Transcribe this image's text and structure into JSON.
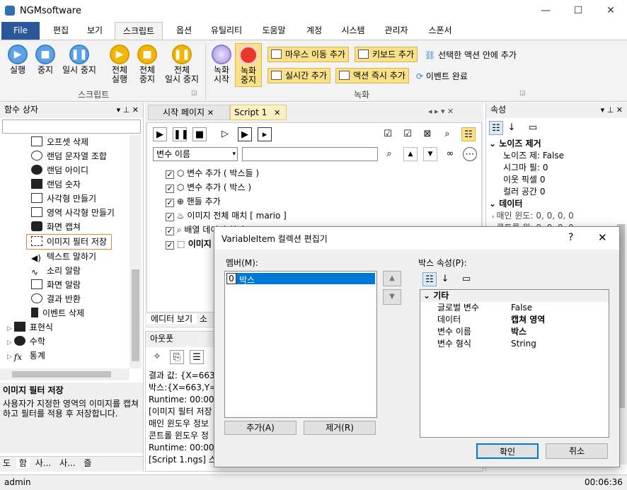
{
  "window": {
    "title": "NGMsoftware",
    "min": "—",
    "max": "☐",
    "close": "✕"
  },
  "tabs": [
    "File",
    "편집",
    "보기",
    "스크립트",
    "옵션",
    "유틸리티",
    "도움말",
    "계정",
    "시스템",
    "관리자",
    "스폰서"
  ],
  "ribbon": {
    "run": "실행",
    "stop": "중지",
    "pause": "일시 중지",
    "all_run": [
      "전체",
      "실행"
    ],
    "all_stop": [
      "전체",
      "중지"
    ],
    "all_pause": [
      "전체",
      "일시 중지"
    ],
    "rec_start": [
      "녹화",
      "시작"
    ],
    "rec_stop": [
      "녹화",
      "중지"
    ],
    "mouse_move": "마우스 이동 추가",
    "keyboard": "키보드 추가",
    "selected_action": "선택한 액션 안에 추가",
    "realtime": "실시간 추가",
    "action_now": "액션 즉시 추가",
    "event_done": "이벤트 완료",
    "group_script": "스크립트",
    "group_record": "녹화"
  },
  "func_panel": {
    "title": "함수 상자",
    "items": [
      "오프셋 삭제",
      "랜덤 문자열 조합",
      "랜덤 아이디",
      "랜덤 숫자",
      "사각형 만들기",
      "영역 사각형 만들기",
      "화면 캡쳐",
      "이미지 필터 저장",
      "텍스트 말하기",
      "소리 알람",
      "화면 알람",
      "결과 반환",
      "이벤트 삭제"
    ],
    "groups": [
      "표현식",
      "수학",
      "통계"
    ],
    "desc_title": "이미지 필터 저장",
    "desc_text": "사용자가 지정한 영역의 이미지를 캡쳐하고 필터를 적용 후 저장합니다.",
    "bottom_tabs": [
      "도",
      "함",
      "사...",
      "사...",
      "즐"
    ]
  },
  "editor": {
    "tab_start": "시작 페이지",
    "tab_script": "Script 1",
    "var_select": "변수 이름",
    "lines": [
      "변수 추가 ( 박스들 )",
      "변수 추가 ( 박스 )",
      "핸들 추가",
      "이미지 전체 매치 [ mario ]",
      "배열 데이터 처리",
      "이미지"
    ],
    "view_tabs": [
      "에디터 보기",
      "소"
    ]
  },
  "output": {
    "title": "아웃풋",
    "lines": [
      "결과 값: {X=663,",
      "박스:{X=663,Y=1",
      "Runtime: 00:00:00",
      "[이미지 필터 저장",
      "매인 윈도우 정보",
      "콘트롤 윈도우 정",
      "Runtime: 00:00:00",
      "[Script 1.ngs] 스크"
    ]
  },
  "props": {
    "title": "속성",
    "cat1": "노이즈 제거",
    "rows1": [
      [
        "노이즈 제:",
        "False"
      ],
      [
        "시그마 필:",
        "0"
      ],
      [
        "이웃 픽셀",
        "0"
      ],
      [
        "컬러 공간",
        "0"
      ]
    ],
    "cat2": "데이터",
    "rows2": [
      [
        "매인 윈도:",
        "0, 0, 0, 0"
      ],
      [
        "콘트롤 윈:",
        "0, 0, 0, 0"
      ]
    ]
  },
  "dialog": {
    "title": "VariableItem 컬렉션 편집기",
    "help": "?",
    "close": "✕",
    "members_label": "멤버(M):",
    "member_index": "0",
    "member_name": "박스",
    "props_label": "박스 속성(P):",
    "cat": "기타",
    "rows": [
      [
        "글로벌 변수",
        "False"
      ],
      [
        "데이터",
        "캡쳐 영역"
      ],
      [
        "변수 이름",
        "박스"
      ],
      [
        "변수 형식",
        "String"
      ]
    ],
    "add": "추가(A)",
    "remove": "제거(R)",
    "ok": "확인",
    "cancel": "취소"
  },
  "status": {
    "user": "admin",
    "time": "00:06:36"
  }
}
